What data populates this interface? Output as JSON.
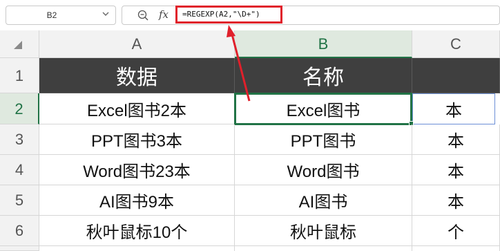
{
  "formula_bar": {
    "name_box": "B2",
    "fx_label": "fx",
    "formula": "=REGEXP(A2,\"\\D+\")"
  },
  "columns": [
    "A",
    "B",
    "C"
  ],
  "rows": [
    "1",
    "2",
    "3",
    "4",
    "5",
    "6"
  ],
  "sheet": {
    "header": {
      "a": "数据",
      "b": "名称",
      "c": ""
    },
    "data": [
      {
        "a": "Excel图书2本",
        "b": "Excel图书",
        "c": "本"
      },
      {
        "a": "PPT图书3本",
        "b": "PPT图书",
        "c": "本"
      },
      {
        "a": "Word图书23本",
        "b": "Word图书",
        "c": "本"
      },
      {
        "a": "AI图书9本",
        "b": "AI图书",
        "c": "本"
      },
      {
        "a": "秋叶鼠标10个",
        "b": "秋叶鼠标",
        "c": "个"
      }
    ]
  },
  "colors": {
    "header_fill": "#3f3f3f",
    "selection": "#217346",
    "annotation": "#e0202b"
  }
}
